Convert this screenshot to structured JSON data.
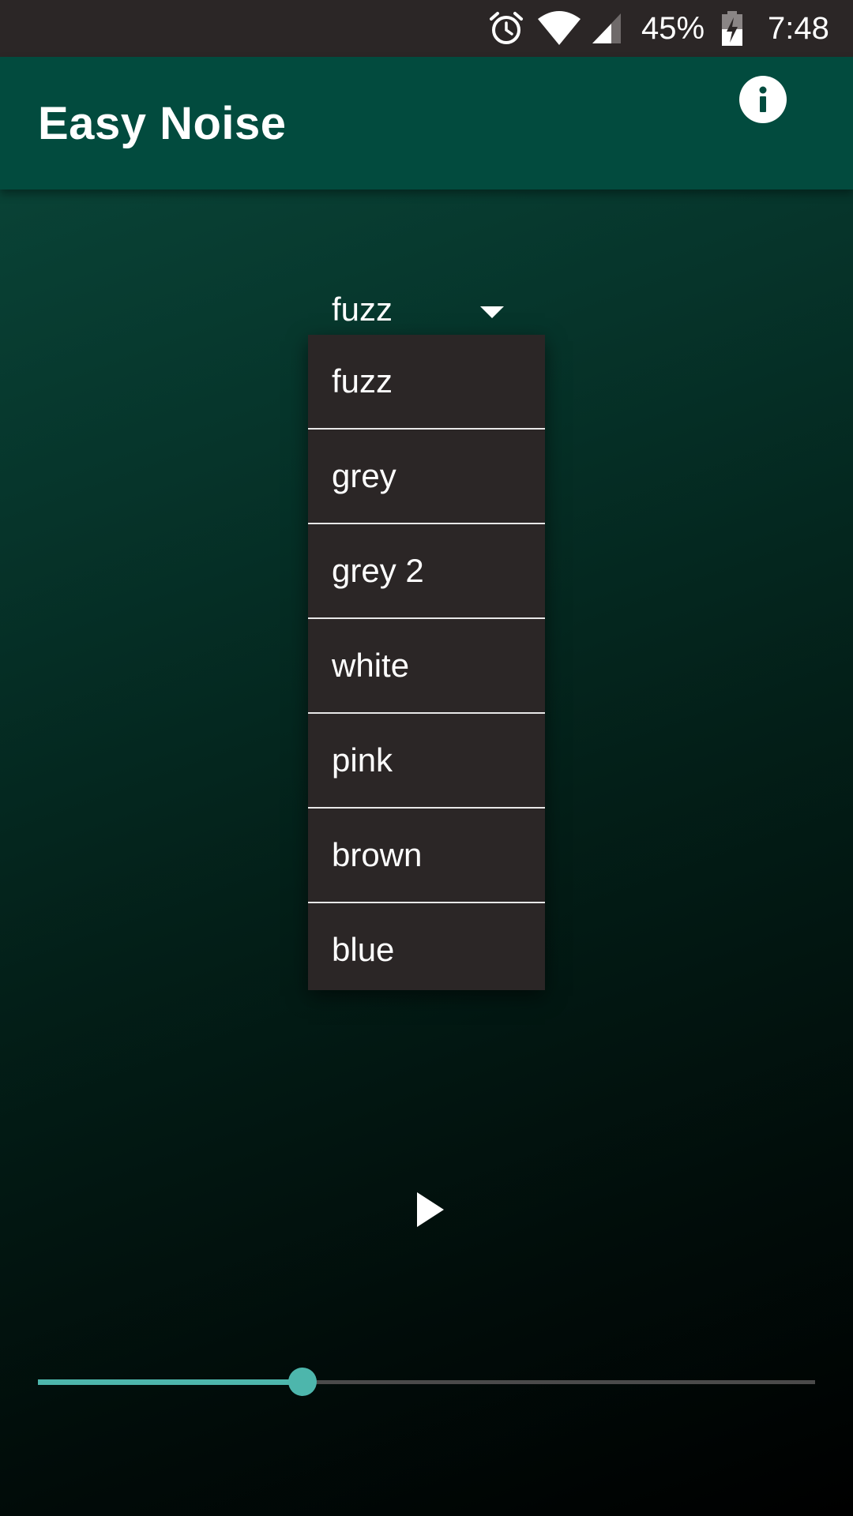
{
  "status_bar": {
    "alarm_icon": "alarm-clock-icon",
    "wifi_icon": "wifi-icon",
    "signal_icon": "cell-signal-icon",
    "battery_percent": "45%",
    "battery_icon": "battery-charging-icon",
    "time": "7:48"
  },
  "app_bar": {
    "title": "Easy Noise",
    "info_icon": "info-icon",
    "background_color": "#024b3e"
  },
  "noise_selector": {
    "selected": "fuzz",
    "arrow_icon": "dropdown-arrow-icon",
    "options": [
      "fuzz",
      "grey",
      "grey 2",
      "white",
      "pink",
      "brown",
      "blue"
    ]
  },
  "player": {
    "play_icon": "play-icon"
  },
  "volume": {
    "level": 0.34,
    "accent_color": "#4db6ac"
  }
}
